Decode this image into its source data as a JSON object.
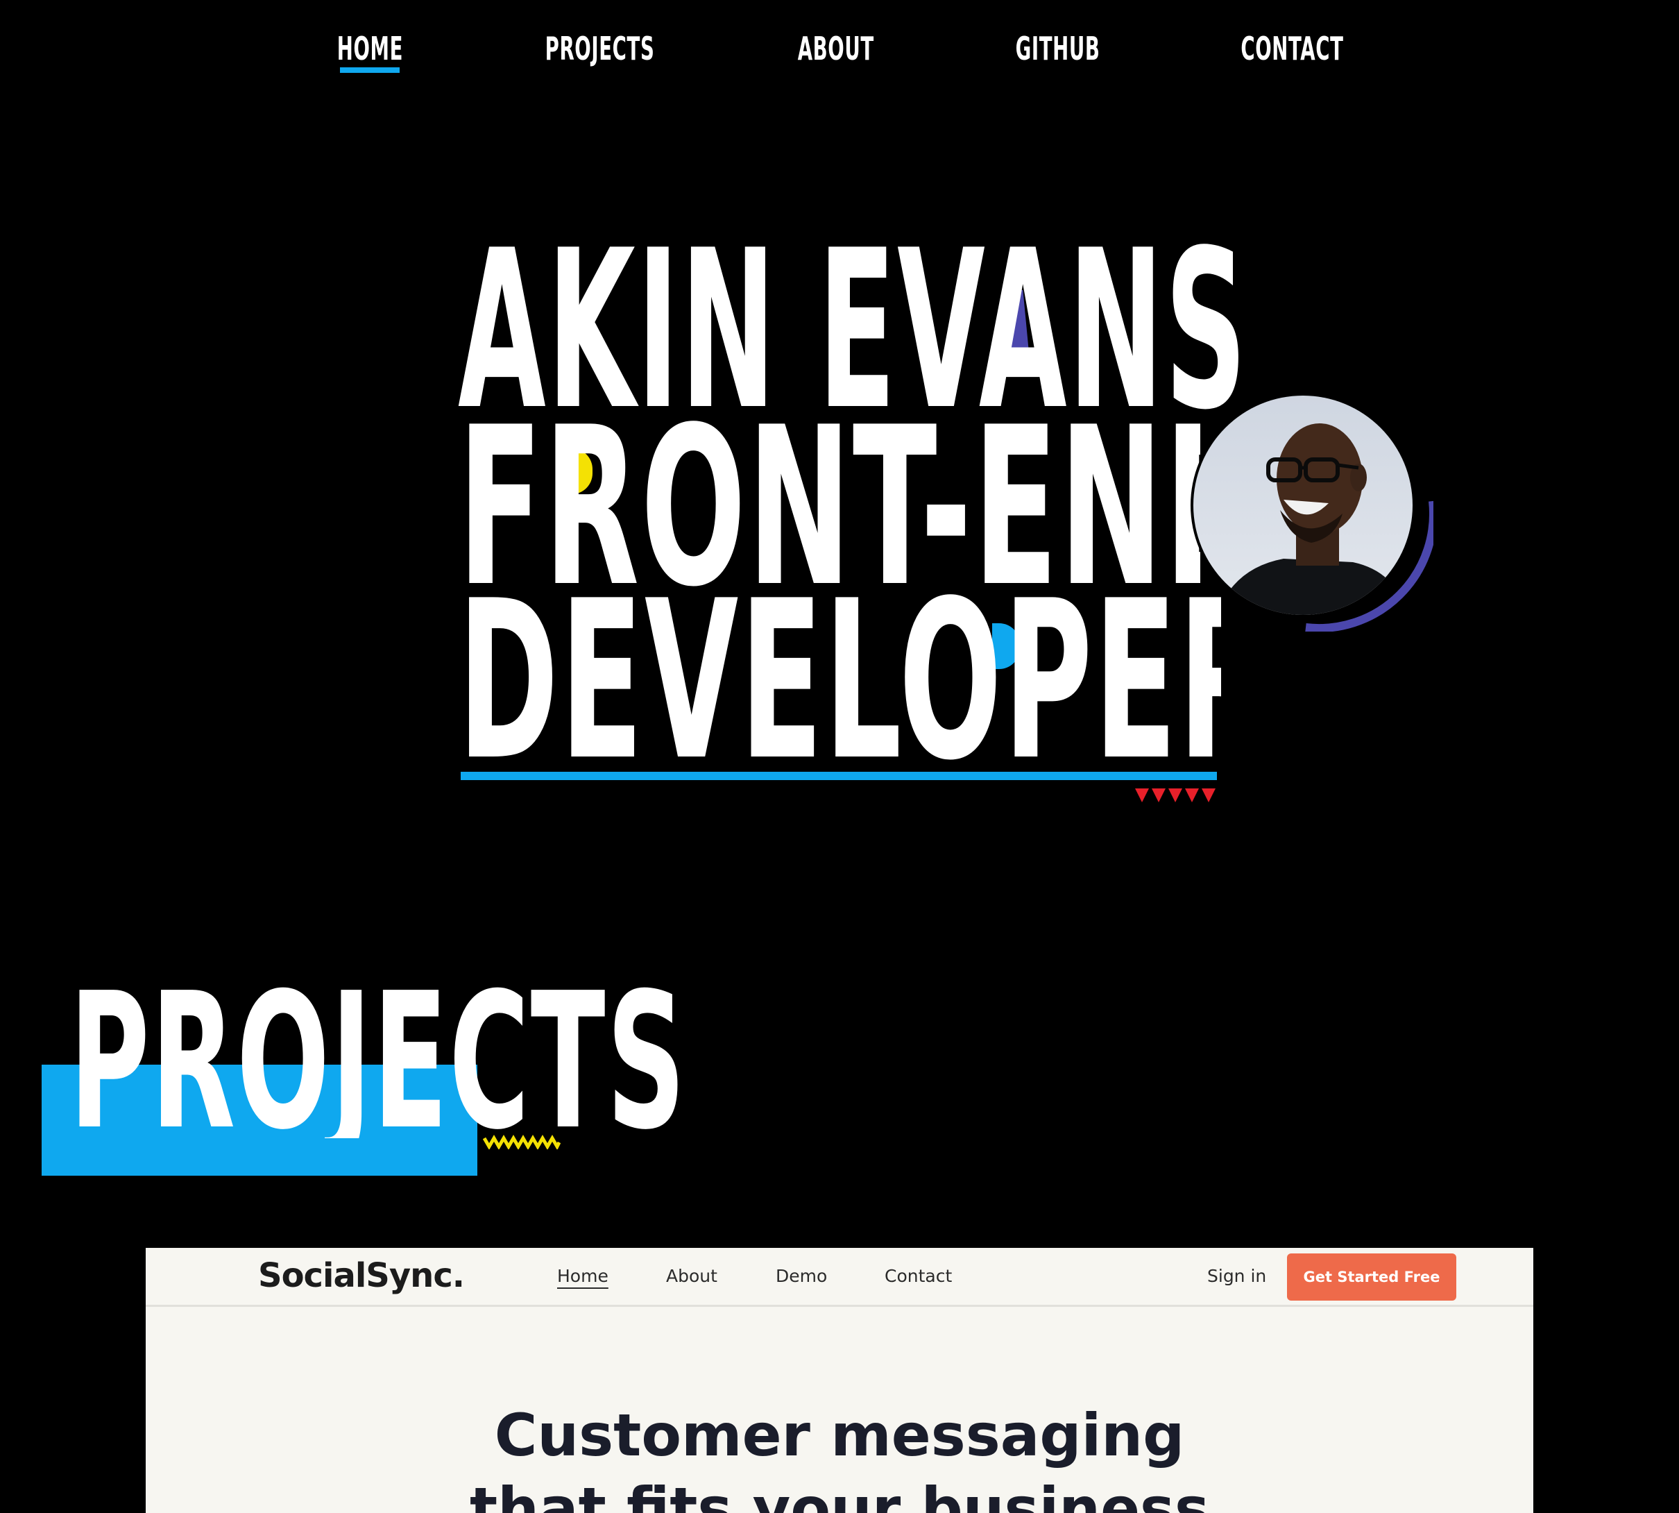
{
  "nav": {
    "items": [
      {
        "label": "HOME",
        "active": true
      },
      {
        "label": "PROJECTS",
        "active": false
      },
      {
        "label": "ABOUT",
        "active": false
      },
      {
        "label": "GITHUB",
        "active": false
      },
      {
        "label": "CONTACT",
        "active": false
      }
    ]
  },
  "hero": {
    "line1": "AKIN EVANS",
    "line2": "FRONT-END",
    "line3": "DEVELOPER",
    "avatar_icon": "portrait-photo"
  },
  "projects": {
    "heading": "PROJECTS"
  },
  "preview": {
    "logo": "SocialSync.",
    "nav": [
      "Home",
      "About",
      "Demo",
      "Contact"
    ],
    "signin": "Sign in",
    "cta": "Get Started Free",
    "headline_1": "Customer messaging",
    "headline_2": "that fits your business"
  },
  "colors": {
    "background": "#000000",
    "text": "#ffffff",
    "accent_blue": "#0fa8ef",
    "accent_purple": "#4b47ad",
    "accent_yellow": "#f4e104",
    "accent_red": "#e8202a",
    "cta_orange": "#ee6a4a"
  }
}
